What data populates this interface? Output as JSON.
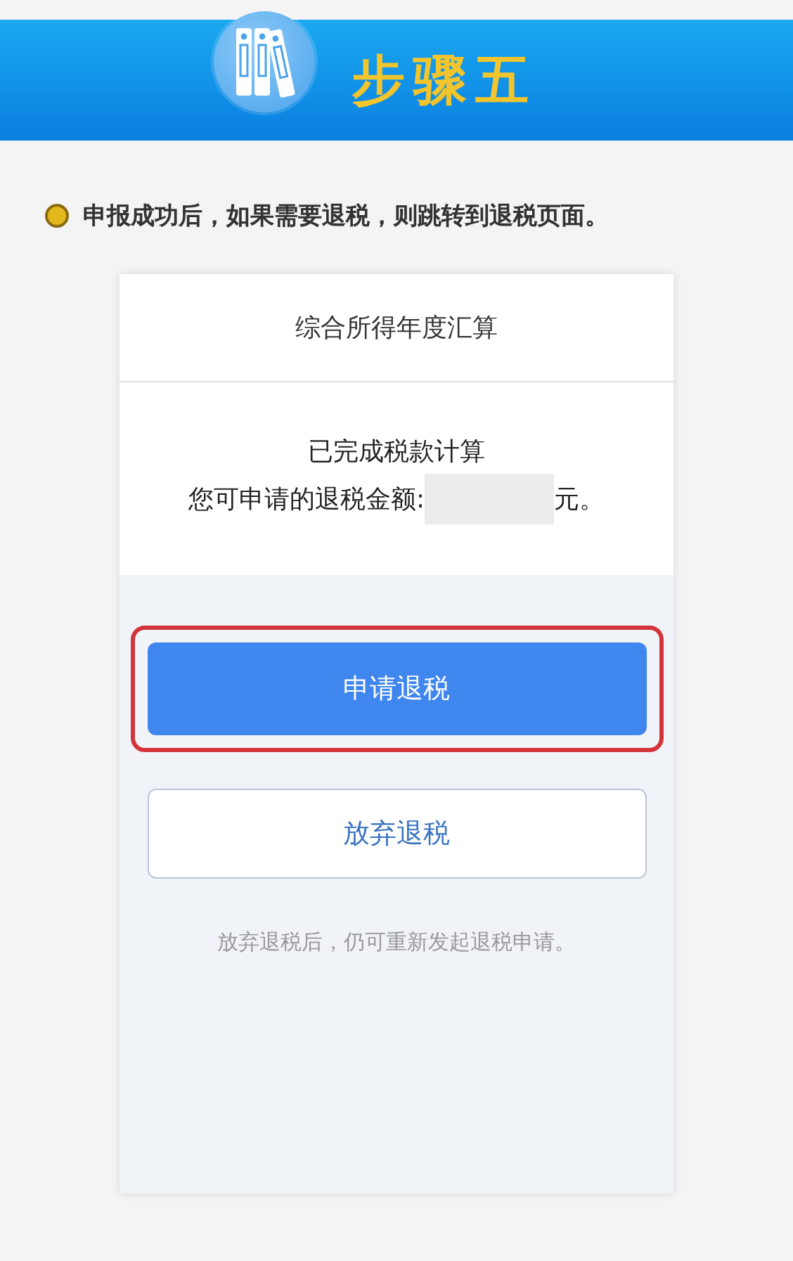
{
  "banner": {
    "title": "步骤五"
  },
  "note": {
    "text": "申报成功后，如果需要退税，则跳转到退税页面。"
  },
  "card": {
    "title": "综合所得年度汇算",
    "status": "已完成税款计算",
    "amount_label": "您可申请的退税金额:",
    "amount_redacted": true,
    "amount_unit": "元。",
    "buttons": [
      {
        "label": "申请退税",
        "kind": "primary",
        "highlighted": true
      },
      {
        "label": "放弃退税",
        "kind": "secondary",
        "highlighted": false
      }
    ],
    "hint": "放弃退税后，仍可重新发起退税申请。"
  }
}
